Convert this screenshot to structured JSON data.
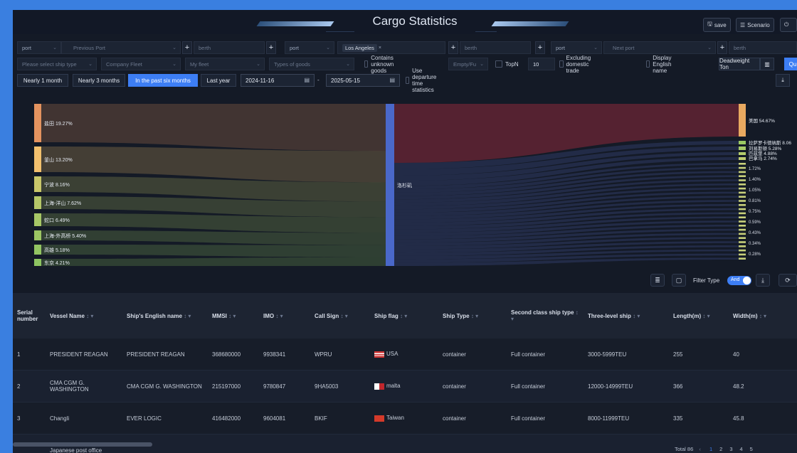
{
  "title": "Cargo Statistics",
  "toolbar": {
    "save": "save",
    "scenario": "Scenario"
  },
  "filters": {
    "row1": {
      "origin_port_label": "port",
      "origin_port_placeholder": "Previous Port",
      "origin_berth_placeholder": "berth",
      "current_port_label": "port",
      "current_port_value": "Los Angeles",
      "current_berth_placeholder": "berth",
      "next_port_label": "port",
      "next_port_placeholder": "Next port",
      "next_berth_placeholder": "berth"
    },
    "row2": {
      "ship_type_placeholder": "Please select ship type",
      "company_fleet_placeholder": "Company Fleet",
      "my_fleet_placeholder": "My fleet",
      "goods_type_placeholder": "Types of goods",
      "contains_unknown": "Contains unknown goods",
      "empty_full_placeholder": "Empty/Fu",
      "topn_label": "TopN",
      "topn_value": "10",
      "excluding_domestic": "Excluding domestic trade",
      "display_english": "Display English name",
      "deadweight": "Deadweight Ton",
      "query_short": "Qu"
    },
    "row3": {
      "ranges": [
        "Nearly 1 month",
        "Nearly 3 months",
        "In the past six months",
        "Last year"
      ],
      "active_range": "In the past six months",
      "start_date": "2024-11-16",
      "end_date": "2025-05-15",
      "date_sep": "-",
      "use_departure": "Use departure time statistics"
    }
  },
  "sankey": {
    "center_label": "洛杉矶",
    "left_nodes": [
      {
        "label": "盐田 19.27%",
        "color": "#e4935f"
      },
      {
        "label": "釜山 13.20%",
        "color": "#f2c06e"
      },
      {
        "label": "宁波 8.16%",
        "color": "#c9c76a"
      },
      {
        "label": "上海-洋山 7.62%",
        "color": "#b6c768"
      },
      {
        "label": "蛇口 6.49%",
        "color": "#a7c766"
      },
      {
        "label": "上海-外高桥 5.40%",
        "color": "#9cc663"
      },
      {
        "label": "高雄 5.18%",
        "color": "#93c562"
      },
      {
        "label": "东京 4.21%",
        "color": "#8dc461"
      }
    ],
    "right_nodes": [
      {
        "label": "美国 54.67%",
        "color": "#e9a960"
      },
      {
        "label": "拉萨罗卡德纳斯 8.06",
        "color": "#9bc963"
      },
      {
        "label": "刘易斯顿 5.28%",
        "color": "#a7cb68"
      },
      {
        "label": "匹兹堡 4.88%",
        "color": "#b3cc6c"
      },
      {
        "label": "巴拿马 2.74%",
        "color": "#bfcd70"
      }
    ],
    "right_small_labels": [
      "1.72%",
      "1.40%",
      "1.05%",
      "0.81%",
      "0.75%",
      "0.59%",
      "0.43%",
      "0.34%",
      "0.28%"
    ]
  },
  "chart_tools": {
    "filter_type": "Filter Type",
    "toggle_label": "And"
  },
  "table": {
    "columns": [
      "Serial number",
      "Vessel Name",
      "Ship's English name",
      "MMSI",
      "IMO",
      "Call Sign",
      "Ship flag",
      "Ship Type",
      "Second class ship type",
      "Three-level ship",
      "Length(m)",
      "Width(m)"
    ],
    "rows": [
      {
        "serial": "1",
        "vessel": "PRESIDENT REAGAN",
        "english": "PRESIDENT REAGAN",
        "mmsi": "368680000",
        "imo": "9938341",
        "call": "WPRU",
        "flag": "USA",
        "type": "container",
        "second": "Full container",
        "third": "3000-5999TEU",
        "length": "255",
        "width": "40"
      },
      {
        "serial": "2",
        "vessel": "CMA CGM G. WASHINGTON",
        "english": "CMA CGM G. WASHINGTON",
        "mmsi": "215197000",
        "imo": "9780847",
        "call": "9HA5003",
        "flag": "malta",
        "type": "container",
        "second": "Full container",
        "third": "12000-14999TEU",
        "length": "366",
        "width": "48.2"
      },
      {
        "serial": "3",
        "vessel": "Changli",
        "english": "EVER LOGIC",
        "mmsi": "416482000",
        "imo": "9604081",
        "call": "BKIF",
        "flag": "Taiwan",
        "type": "container",
        "second": "Full container",
        "third": "8000-11999TEU",
        "length": "335",
        "width": "45.8"
      },
      {
        "serial": "",
        "vessel": "Japanese post office",
        "english": "",
        "mmsi": "",
        "imo": "",
        "call": "",
        "flag": "",
        "type": "",
        "second": "",
        "third": "",
        "length": "",
        "width": ""
      }
    ]
  },
  "pagination": {
    "total": "Total 86",
    "pages": [
      "1",
      "2",
      "3",
      "4",
      "5"
    ]
  },
  "colors": {
    "accent": "#3d7ef4",
    "background": "#141a26",
    "center_node": "#4a68c9",
    "top_link": "#8a2a3a"
  }
}
